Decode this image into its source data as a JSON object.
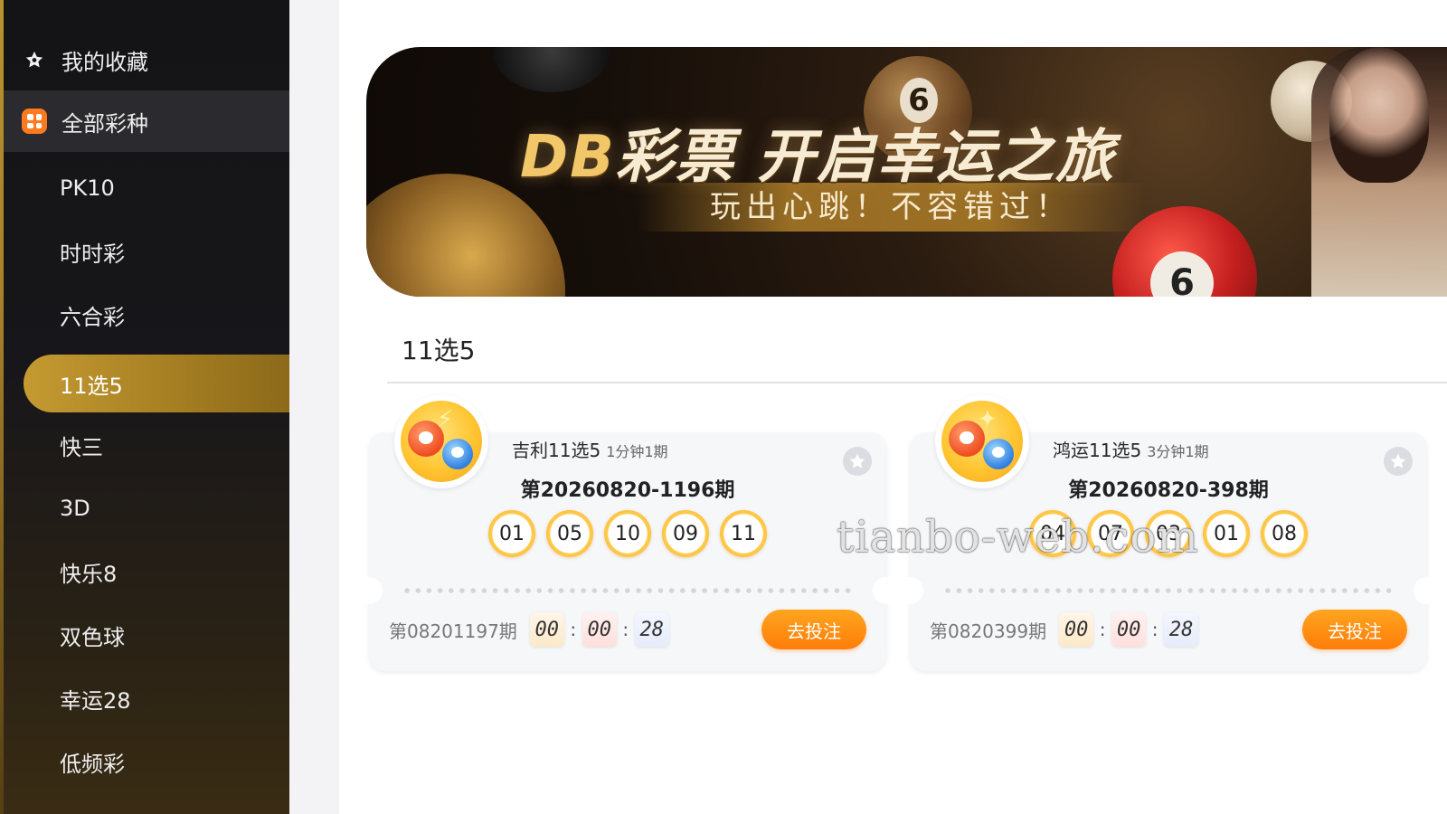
{
  "sidebar": {
    "items": [
      {
        "label": "我的收藏",
        "icon": "star-icon"
      },
      {
        "label": "全部彩种",
        "icon": "grid-icon"
      },
      {
        "label": "PK10"
      },
      {
        "label": "时时彩"
      },
      {
        "label": "六合彩"
      },
      {
        "label": "11选5",
        "active": true
      },
      {
        "label": "快三"
      },
      {
        "label": "3D"
      },
      {
        "label": "快乐8"
      },
      {
        "label": "双色球"
      },
      {
        "label": "幸运28"
      },
      {
        "label": "低频彩"
      }
    ]
  },
  "banner": {
    "title_brand": "DB",
    "title_rest": "彩票 开启幸运之旅",
    "subtitle": "玩出心跳！不容错过！",
    "ball_six": "6",
    "ball_red": "6"
  },
  "section": {
    "title": "11选5"
  },
  "cards": [
    {
      "name": "吉利11选5",
      "frequency": "1分钟1期",
      "issue": "第20260820-1196期",
      "numbers": [
        "01",
        "05",
        "10",
        "09",
        "11"
      ],
      "next_issue": "第08201197期",
      "countdown": {
        "h": "00",
        "m": "00",
        "s": "28"
      },
      "bet_label": "去投注"
    },
    {
      "name": "鸿运11选5",
      "frequency": "3分钟1期",
      "issue": "第20260820-398期",
      "numbers": [
        "04",
        "07",
        "03",
        "01",
        "08"
      ],
      "next_issue": "第0820399期",
      "countdown": {
        "h": "00",
        "m": "00",
        "s": "28"
      },
      "bet_label": "去投注"
    }
  ],
  "watermark": "tianbo-web.com",
  "colors": {
    "accent": "#c49a31",
    "button": "#ff7d0a",
    "ball_ring": "#f5a623"
  }
}
